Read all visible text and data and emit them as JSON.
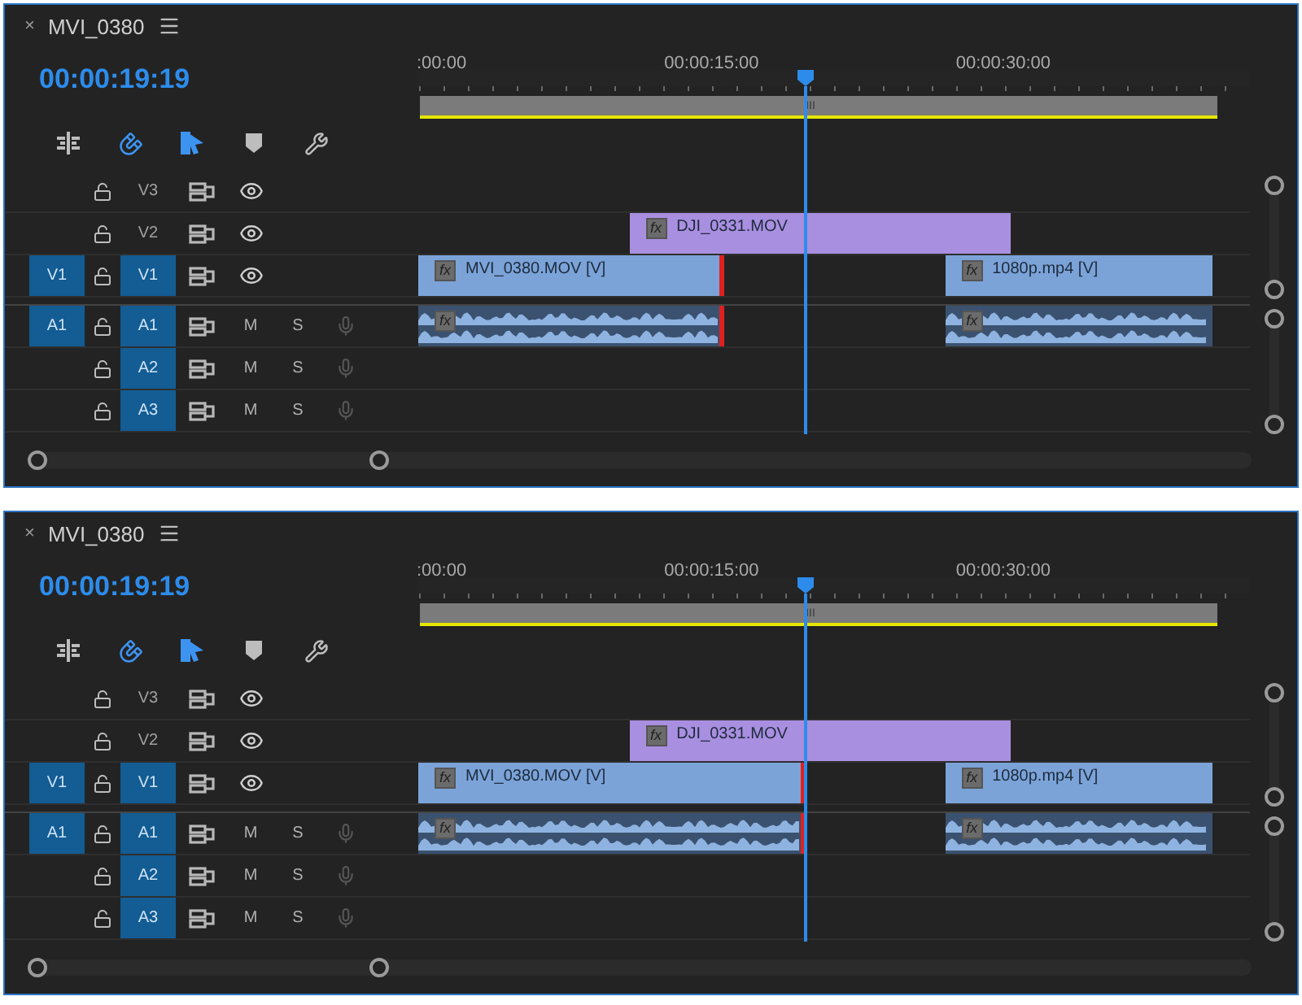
{
  "panels": [
    {
      "close": "×",
      "title": "MVI_0380",
      "timecode": "00:00:19:19",
      "toolbar": [
        {
          "kind": "nest",
          "on": false
        },
        {
          "kind": "snap",
          "on": true
        },
        {
          "kind": "linked",
          "on": true
        },
        {
          "kind": "marker",
          "on": false
        },
        {
          "kind": "settings",
          "on": false
        }
      ],
      "ruler": [
        ":00:00",
        "00:00:15:00",
        "00:00:30:00"
      ],
      "playhead": {
        "level": 0.467
      },
      "work_area_marker": "III",
      "tracks": [
        {
          "kind": "video",
          "label": "V3",
          "targeted": false
        },
        {
          "kind": "video",
          "label": "V2",
          "targeted": false,
          "clips": [
            {
              "kind": "adjustment",
              "badge": "fx",
              "name": "DJI_0331.MOV",
              "ends_at_playhead": false
            }
          ]
        },
        {
          "kind": "video",
          "source": "V1",
          "label": "V1",
          "targeted": true,
          "clips": [
            {
              "kind": "video",
              "badge": "fx",
              "name": "MVI_0380.MOV [V]",
              "ends_at_playhead": false
            },
            {
              "kind": "video",
              "badge": "fx",
              "name": "1080p.mp4 [V]",
              "ends_at_playhead": false
            }
          ]
        },
        {
          "kind": "audio",
          "source": "A1",
          "label": "A1",
          "targeted": true,
          "mute": "M",
          "solo": "S",
          "clips": [
            {
              "kind": "audio",
              "badge": "fx",
              "ends_at_playhead": false
            },
            {
              "kind": "audio",
              "badge": "fx",
              "ends_at_playhead": false
            }
          ]
        },
        {
          "kind": "audio",
          "label": "A2",
          "targeted": true,
          "mute": "M",
          "solo": "S"
        },
        {
          "kind": "audio",
          "label": "A3",
          "targeted": true,
          "mute": "M",
          "solo": "S"
        }
      ]
    },
    {
      "close": "×",
      "title": "MVI_0380",
      "timecode": "00:00:19:19",
      "toolbar": [
        {
          "kind": "nest",
          "on": false
        },
        {
          "kind": "snap",
          "on": true
        },
        {
          "kind": "linked",
          "on": true
        },
        {
          "kind": "marker",
          "on": false
        },
        {
          "kind": "settings",
          "on": false
        }
      ],
      "ruler": [
        ":00:00",
        "00:00:15:00",
        "00:00:30:00"
      ],
      "playhead": {
        "level": 0.467
      },
      "work_area_marker": "III",
      "tracks": [
        {
          "kind": "video",
          "label": "V3",
          "targeted": false
        },
        {
          "kind": "video",
          "label": "V2",
          "targeted": false,
          "clips": [
            {
              "kind": "adjustment",
              "badge": "fx",
              "name": "DJI_0331.MOV",
              "ends_at_playhead": false
            }
          ]
        },
        {
          "kind": "video",
          "source": "V1",
          "label": "V1",
          "targeted": true,
          "clips": [
            {
              "kind": "video",
              "badge": "fx",
              "name": "MVI_0380.MOV [V]",
              "ends_at_playhead": true
            },
            {
              "kind": "video",
              "badge": "fx",
              "name": "1080p.mp4 [V]",
              "ends_at_playhead": false
            }
          ]
        },
        {
          "kind": "audio",
          "source": "A1",
          "label": "A1",
          "targeted": true,
          "mute": "M",
          "solo": "S",
          "clips": [
            {
              "kind": "audio",
              "badge": "fx",
              "ends_at_playhead": true
            },
            {
              "kind": "audio",
              "badge": "fx",
              "ends_at_playhead": false
            }
          ]
        },
        {
          "kind": "audio",
          "label": "A2",
          "targeted": true,
          "mute": "M",
          "solo": "S"
        },
        {
          "kind": "audio",
          "label": "A3",
          "targeted": true,
          "mute": "M",
          "solo": "S"
        }
      ]
    }
  ]
}
